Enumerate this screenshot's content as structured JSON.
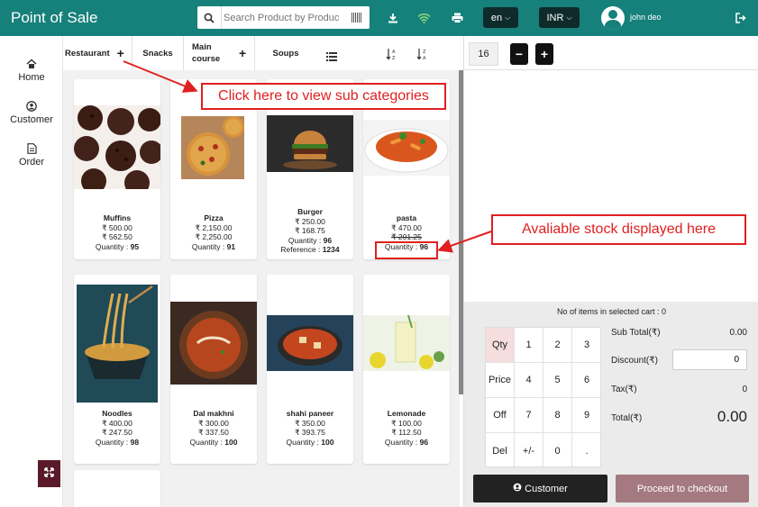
{
  "header": {
    "title": "Point of Sale",
    "search_placeholder": "Search Product by Product",
    "language": "en",
    "currency": "INR",
    "user_name": "john deo"
  },
  "sidebar": {
    "items": [
      {
        "label": "Home",
        "icon": "home-icon"
      },
      {
        "label": "Customer",
        "icon": "user-icon"
      },
      {
        "label": "Order",
        "icon": "file-icon"
      }
    ]
  },
  "categories": {
    "restaurant": "Restaurant",
    "snacks": "Snacks",
    "main_course": "Main course",
    "soups": "Soups"
  },
  "products": [
    {
      "name": "Muffins",
      "price1": "₹ 500.00",
      "price2": "₹ 562.50",
      "qty_label": "Quantity :",
      "qty": "95"
    },
    {
      "name": "Pizza",
      "price1": "₹ 2,150.00",
      "price2": "₹ 2,250.00",
      "qty_label": "Quantity :",
      "qty": "91"
    },
    {
      "name": "Burger",
      "price1": "₹ 250.00",
      "price2": "₹ 168.75",
      "qty_label": "Quantity :",
      "qty": "96",
      "ref_label": "Reference :",
      "ref": "1234"
    },
    {
      "name": "pasta",
      "price1": "₹ 470.00",
      "price2": "₹ 201.25",
      "qty_label": "Quantity :",
      "qty": "96"
    },
    {
      "name": "Noodles",
      "price1": "₹ 400.00",
      "price2": "₹ 247.50",
      "qty_label": "Quantity :",
      "qty": "98"
    },
    {
      "name": "Dal makhni",
      "price1": "₹ 300.00",
      "price2": "₹ 337.50",
      "qty_label": "Quantity :",
      "qty": "100"
    },
    {
      "name": "shahi paneer",
      "price1": "₹ 350.00",
      "price2": "₹ 393.75",
      "qty_label": "Quantity :",
      "qty": "100"
    },
    {
      "name": "Lemonade",
      "price1": "₹ 100.00",
      "price2": "₹ 112.50",
      "qty_label": "Quantity :",
      "qty": "96"
    }
  ],
  "cart": {
    "table_number": "16",
    "minus": "−",
    "plus": "+",
    "items_label": "No of items in selected cart :",
    "items_count": "0"
  },
  "keypad": {
    "keys": [
      "Qty",
      "1",
      "2",
      "3",
      "Price",
      "4",
      "5",
      "6",
      "Off",
      "7",
      "8",
      "9",
      "Del",
      "+/-",
      "0",
      "."
    ]
  },
  "summary": {
    "subtotal_label": "Sub Total(₹)",
    "subtotal": "0.00",
    "discount_label": "Discount(₹)",
    "discount": "0",
    "tax_label": "Tax(₹)",
    "tax": "0",
    "total_label": "Total(₹)",
    "total": "0.00"
  },
  "buttons": {
    "customer": "Customer",
    "checkout": "Proceed to checkout"
  },
  "annotations": {
    "subcategories": "Click here to view sub categories",
    "stock": "Avaliable stock displayed here",
    "color": "#e02020"
  }
}
